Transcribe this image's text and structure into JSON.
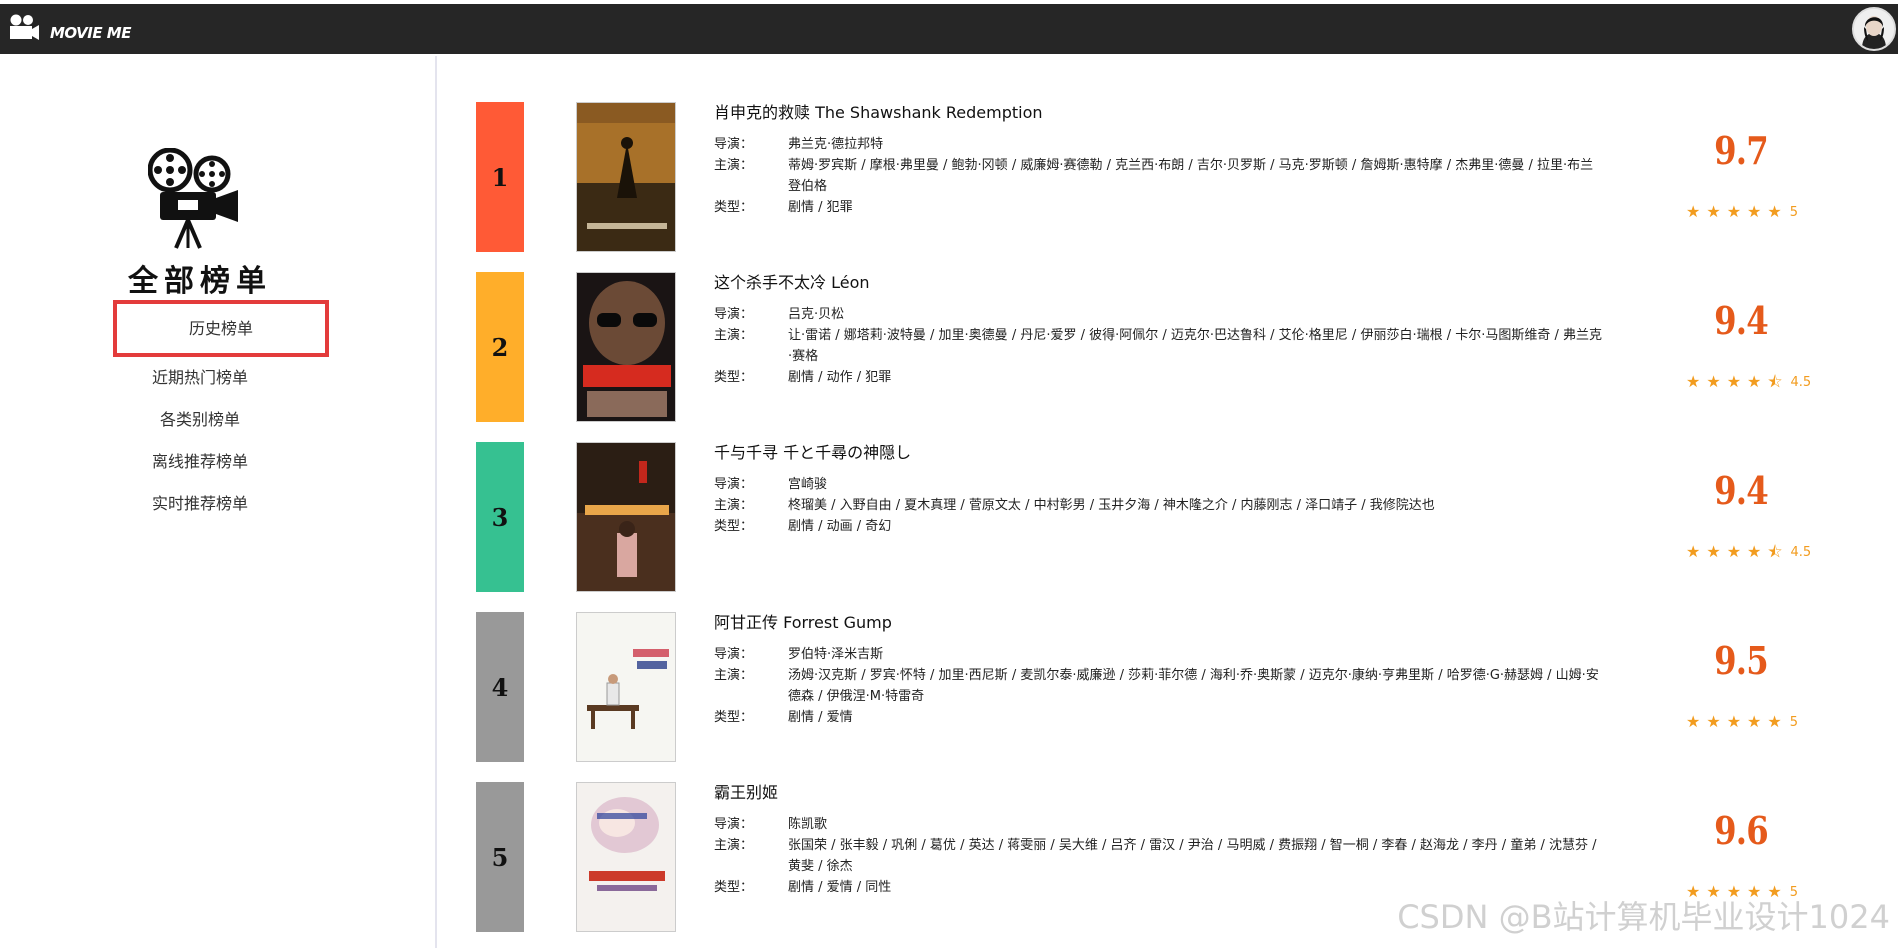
{
  "header": {
    "brand": "MOVIE ME"
  },
  "sidebar": {
    "title": "全部榜单",
    "items": [
      {
        "label": "历史榜单",
        "active": true
      },
      {
        "label": "近期热门榜单",
        "active": false
      },
      {
        "label": "各类别榜单",
        "active": false
      },
      {
        "label": "离线推荐榜单",
        "active": false
      },
      {
        "label": "实时推荐榜单",
        "active": false
      }
    ]
  },
  "labels": {
    "director": "导演：",
    "cast": "主演：",
    "genre": "类型："
  },
  "movies": [
    {
      "rank": "1",
      "rank_color": "#ff5a36",
      "title": "肖申克的救赎 The Shawshank Redemption",
      "director": "弗兰克·德拉邦特",
      "cast": "蒂姆·罗宾斯 / 摩根·弗里曼 / 鲍勃·冈顿 / 威廉姆·赛德勒 / 克兰西·布朗 / 吉尔·贝罗斯 / 马克·罗斯顿 / 詹姆斯·惠特摩 / 杰弗里·德曼 / 拉里·布兰登伯格",
      "genre": "剧情 / 犯罪",
      "score": "9.7",
      "stars": "5"
    },
    {
      "rank": "2",
      "rank_color": "#ffae2a",
      "title": "这个杀手不太冷 Léon",
      "director": "吕克·贝松",
      "cast": "让·雷诺 / 娜塔莉·波特曼 / 加里·奥德曼 / 丹尼·爱罗 / 彼得·阿佩尔 / 迈克尔·巴达鲁科 / 艾伦·格里尼 / 伊丽莎白·瑞根 / 卡尔·马图斯维奇 / 弗兰克·赛格",
      "genre": "剧情 / 动作 / 犯罪",
      "score": "9.4",
      "stars": "4.5"
    },
    {
      "rank": "3",
      "rank_color": "#36c191",
      "title": "千与千寻 千と千尋の神隠し",
      "director": "宫崎骏",
      "cast": "柊瑠美 / 入野自由 / 夏木真理 / 菅原文太 / 中村彰男 / 玉井夕海 / 神木隆之介 / 内藤刚志 / 泽口靖子 / 我修院达也",
      "genre": "剧情 / 动画 / 奇幻",
      "score": "9.4",
      "stars": "4.5"
    },
    {
      "rank": "4",
      "rank_color": "#999999",
      "title": "阿甘正传 Forrest Gump",
      "director": "罗伯特·泽米吉斯",
      "cast": "汤姆·汉克斯 / 罗宾·怀特 / 加里·西尼斯 / 麦凯尔泰·威廉逊 / 莎莉·菲尔德 / 海利·乔·奥斯蒙 / 迈克尔·康纳·亨弗里斯 / 哈罗德·G·赫瑟姆 / 山姆·安德森 / 伊俄涅·M·特雷奇",
      "genre": "剧情 / 爱情",
      "score": "9.5",
      "stars": "5"
    },
    {
      "rank": "5",
      "rank_color": "#999999",
      "title": "霸王别姬",
      "director": "陈凯歌",
      "cast": "张国荣 / 张丰毅 / 巩俐 / 葛优 / 英达 / 蒋雯丽 / 吴大维 / 吕齐 / 雷汉 / 尹治 / 马明威 / 费振翔 / 智一桐 / 李春 / 赵海龙 / 李丹 / 童弟 / 沈慧芬 / 黄斐 / 徐杰",
      "genre": "剧情 / 爱情 / 同性",
      "score": "9.6",
      "stars": "5"
    }
  ],
  "watermark": "CSDN @B站计算机毕业设计1024"
}
